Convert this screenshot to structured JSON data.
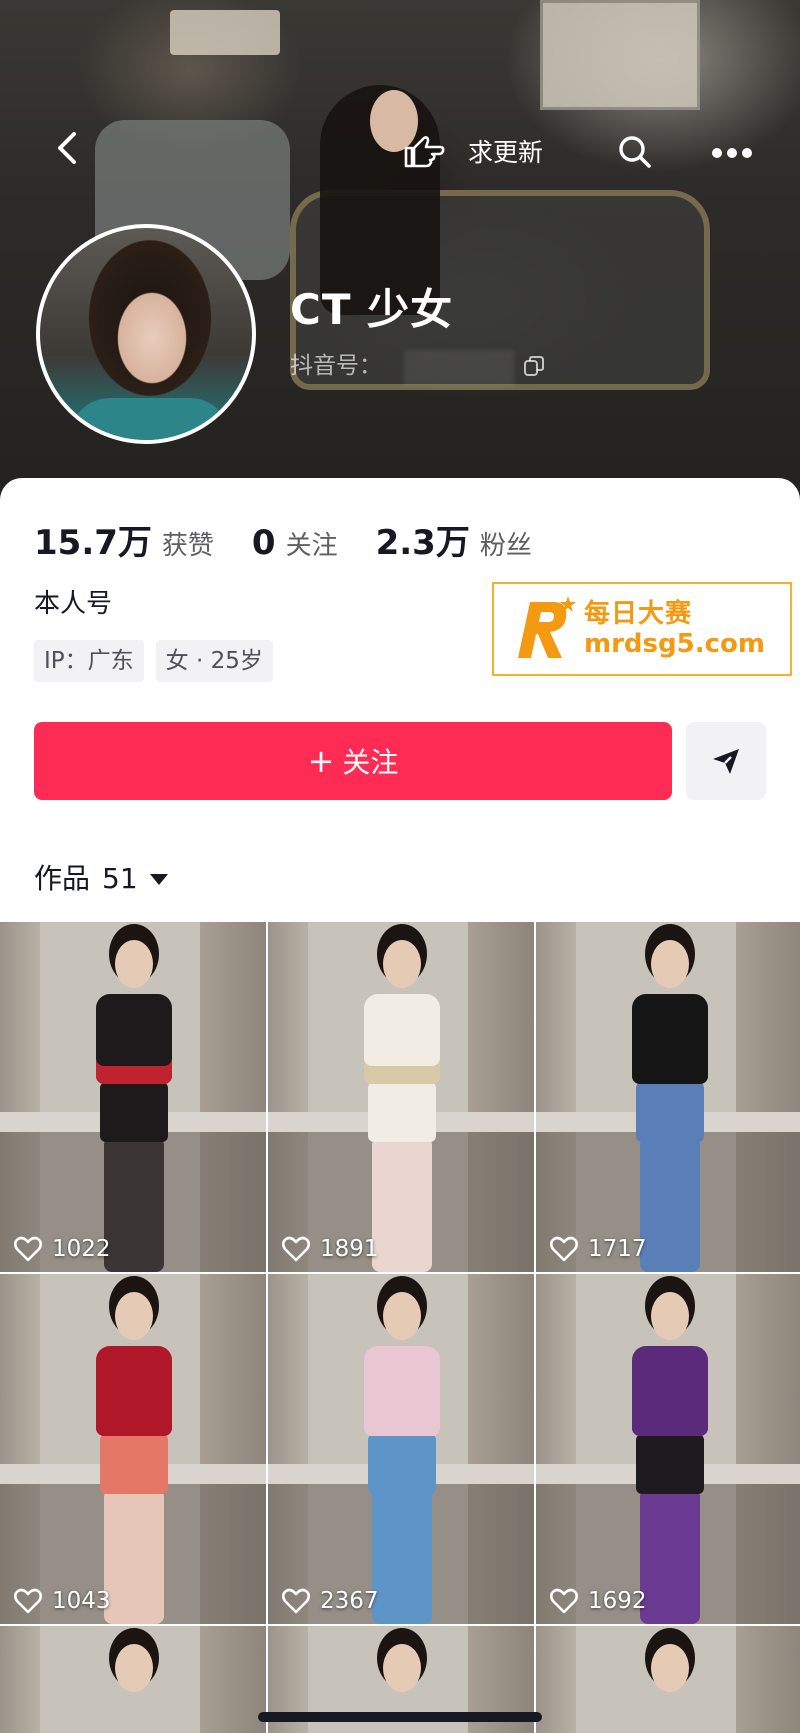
{
  "header": {
    "update_label": "求更新"
  },
  "profile": {
    "nickname": "CT 少女",
    "douyin_id_label": "抖音号：",
    "stats": [
      {
        "value": "15.7万",
        "label": "获赞"
      },
      {
        "value": "0",
        "label": "关注"
      },
      {
        "value": "2.3万",
        "label": "粉丝"
      }
    ],
    "bio": "本人号",
    "tags": [
      "IP：广东",
      "女 · 25岁"
    ]
  },
  "watermark": {
    "line1": "每日大赛",
    "line2": "mrdsg5.com"
  },
  "actions": {
    "follow_plus": "+",
    "follow_label": "关注"
  },
  "works": {
    "label": "作品",
    "count": "51",
    "videos": [
      {
        "likes": "1022",
        "top_color": "#1e1a1c",
        "accent": "#c0232f",
        "bottom_color": "#1e1a1c",
        "legs_color": "#3b3535"
      },
      {
        "likes": "1891",
        "top_color": "#f1ece4",
        "accent": "#d8c9a8",
        "bottom_color": "#f1ece4",
        "legs_color": "#e9d6d0"
      },
      {
        "likes": "1717",
        "top_color": "#161616",
        "accent": "#161616",
        "bottom_color": "#5a7fb8",
        "legs_color": "#5a7fb8"
      },
      {
        "likes": "1043",
        "top_color": "#b0182a",
        "accent": "#b0182a",
        "bottom_color": "#e47766",
        "legs_color": "#e6c6b8"
      },
      {
        "likes": "2367",
        "top_color": "#e9c7d2",
        "accent": "#e9c7d2",
        "bottom_color": "#5e95c9",
        "legs_color": "#5e95c9"
      },
      {
        "likes": "1692",
        "top_color": "#5b2a7a",
        "accent": "#5b2a7a",
        "bottom_color": "#1d1a20",
        "legs_color": "#6a3a92"
      }
    ]
  },
  "colors": {
    "brand_red": "#fe2c55",
    "watermark_orange": "#f39a12"
  }
}
